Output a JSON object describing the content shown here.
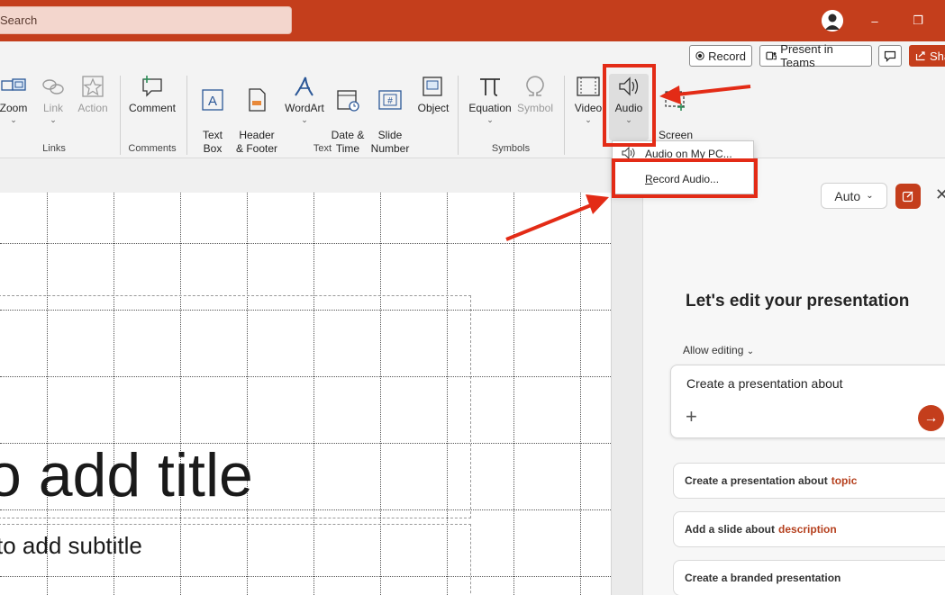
{
  "titlebar": {
    "search_placeholder": "Search",
    "minimize_glyph": "–",
    "restore_glyph": "❐"
  },
  "commandbar": {
    "record_label": "Record",
    "present_teams_label": "Present in Teams",
    "share_label": "Sha"
  },
  "ribbon": {
    "buttons": [
      {
        "label": "Zoom",
        "icon": "zoom-icon"
      },
      {
        "label": "Link",
        "icon": "link-icon"
      },
      {
        "label": "Action",
        "icon": "action-star-icon"
      },
      {
        "label": "Comment",
        "icon": "comment-icon"
      },
      {
        "label": "Text\nBox",
        "icon": "text-box-icon"
      },
      {
        "label": "Header\n& Footer",
        "icon": "header-footer-icon"
      },
      {
        "label": "WordArt",
        "icon": "wordart-icon"
      },
      {
        "label": "Date &\nTime",
        "icon": "date-time-icon"
      },
      {
        "label": "Slide\nNumber",
        "icon": "slide-number-icon"
      },
      {
        "label": "Object",
        "icon": "object-icon"
      },
      {
        "label": "Equation",
        "icon": "equation-icon"
      },
      {
        "label": "Symbol",
        "icon": "symbol-icon"
      },
      {
        "label": "Video",
        "icon": "video-icon"
      },
      {
        "label": "Audio",
        "icon": "audio-icon"
      },
      {
        "label": "Screen\nRecording",
        "icon": "screen-recording-icon"
      }
    ],
    "groups": [
      "Links",
      "Comments",
      "Text",
      "Symbols"
    ]
  },
  "audio_menu": {
    "items": [
      "Audio on My PC...",
      "Record Audio..."
    ]
  },
  "slide": {
    "title_text": "o add title",
    "subtitle_text": "to add subtitle"
  },
  "copilot": {
    "mode_label": "Auto",
    "heading": "Let's edit your presentation",
    "allow_editing": "Allow editing",
    "prompt_text": "Create a presentation about",
    "suggestions": [
      {
        "text": "Create a presentation about",
        "highlight": "topic"
      },
      {
        "text": "Add a slide about",
        "highlight": "description"
      },
      {
        "text": "Create a branded presentation",
        "highlight": ""
      }
    ]
  },
  "colors": {
    "accent": "#c43e1c",
    "annotation": "#e32b16"
  }
}
